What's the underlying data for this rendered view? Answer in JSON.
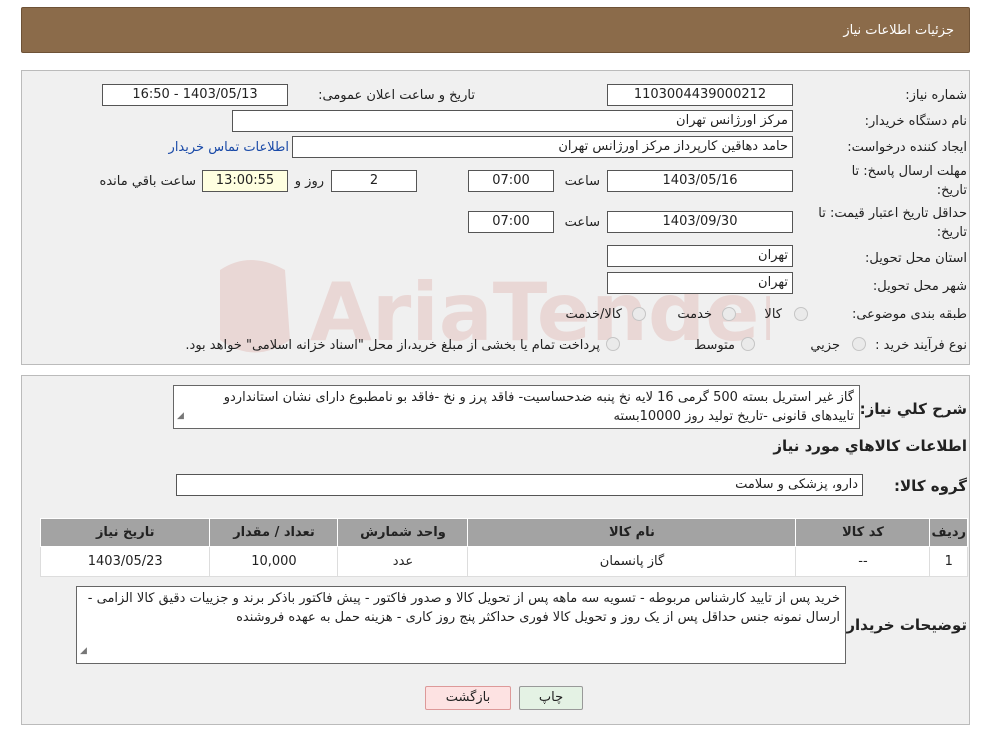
{
  "header": {
    "title": "جزئیات اطلاعات نیاز"
  },
  "form": {
    "need_number_label": "شماره نیاز:",
    "need_number": "1103004439000212",
    "announce_label": "تاریخ و ساعت اعلان عمومی:",
    "announce_value": "1403/05/13 - 16:50",
    "buyer_label": "نام دستگاه خریدار:",
    "buyer_value": "مرکز اورژانس تهران",
    "creator_label": "ایجاد کننده درخواست:",
    "creator_value": "حامد دهاقین کارپرداز مرکز اورژانس تهران",
    "contact_link": "اطلاعات تماس خریدار",
    "deadline_label_1": "مهلت ارسال پاسخ: تا",
    "deadline_label_2": "تاریخ:",
    "deadline_date": "1403/05/16",
    "time_label": "ساعت",
    "deadline_time": "07:00",
    "days_value": "2",
    "days_label": "روز و",
    "remaining_time": "13:00:55",
    "remaining_label": "ساعت باقي مانده",
    "validity_label_1": "حداقل تاریخ اعتبار قیمت: تا",
    "validity_label_2": "تاریخ:",
    "validity_date": "1403/09/30",
    "validity_time": "07:00",
    "province_label": "استان محل تحویل:",
    "province_value": "تهران",
    "city_label": "شهر محل تحویل:",
    "city_value": "تهران",
    "category_label": "طبقه بندی موضوعی:",
    "category_options": [
      "کالا",
      "خدمت",
      "کالا/خدمت"
    ],
    "process_label": "نوع فرآیند خرید :",
    "process_options": [
      "جزيي",
      "متوسط"
    ],
    "process_note": "پرداخت تمام یا بخشی از مبلغ خرید،از محل \"اسناد خزانه اسلامی\" خواهد بود."
  },
  "description": {
    "label": "شرح کلي نياز:",
    "text": "گاز غیر استریل بسته 500 گرمی 16 لایه نخ پنبه ضدحساسیت- فاقد پرز و نخ -فاقد بو نامطبوع دارای نشان استانداردو تاییدهای قانونی -تاریخ تولید روز 10000بسته",
    "items_heading": "اطلاعات کالاهاي مورد نياز",
    "group_label": "گروه کالا:",
    "group_value": "دارو، پزشکی و سلامت"
  },
  "table": {
    "headers": [
      "رديف",
      "کد کالا",
      "نام کالا",
      "واحد شمارش",
      "تعداد / مقدار",
      "تاریخ نیاز"
    ],
    "rows": [
      [
        "1",
        "--",
        "گاز پانسمان",
        "عدد",
        "10,000",
        "1403/05/23"
      ]
    ]
  },
  "buyer_notes": {
    "label": "توضیحات خریدار:",
    "text": "خرید پس از تایید کارشناس مربوطه - تسویه سه ماهه پس از تحویل کالا و صدور فاکتور - پیش فاکتور باذکر برند و جزییات دقیق کالا الزامی - ارسال نمونه جنس حداقل پس از یک روز و تحویل کالا فوری حداکثر پنج روز کاری - هزینه حمل به عهده فروشنده"
  },
  "buttons": {
    "print": "چاپ",
    "back": "بازگشت"
  },
  "colors": {
    "header_bg": "#8b6b4a",
    "panel_bg": "#f0f0f0",
    "table_header_bg": "#a3a3a3",
    "back_button_bg": "#fde2e2",
    "print_button_bg": "#e4f2e4"
  },
  "watermark": {
    "text": "AriaTender.neT"
  }
}
